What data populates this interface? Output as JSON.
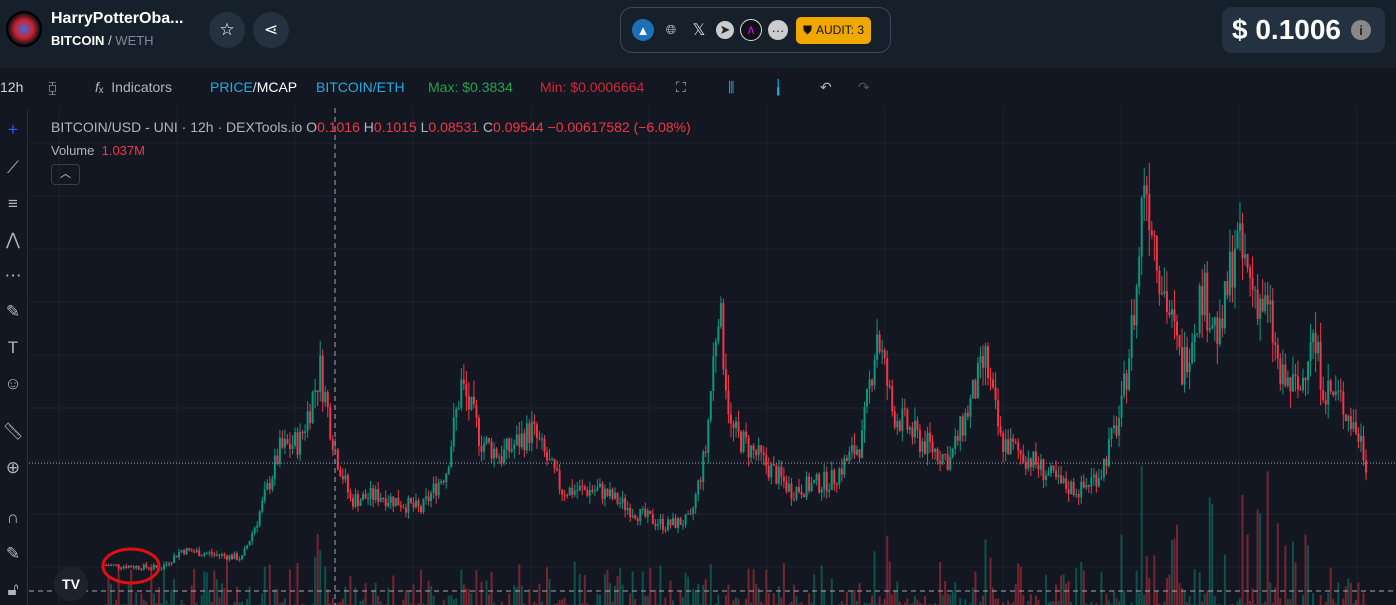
{
  "header": {
    "token_name": "HarryPotterOba...",
    "base": "BITCOIN",
    "quote": "WETH",
    "audit_label": "AUDIT: 3",
    "price": "$ 0.1006",
    "info": "i"
  },
  "toolbar": {
    "interval": "12h",
    "indicators": "Indicators",
    "price": "PRICE",
    "mcap": "MCAP",
    "pair_toggle": "BITCOIN/ETH",
    "max": "Max: $0.3834",
    "min": "Min: $0.0006664"
  },
  "legend": {
    "title": "BITCOIN/USD - UNI · 12h · DEXTools.io",
    "o_label": "O",
    "o": "0.1016",
    "h_label": "H",
    "h": "0.1015",
    "l_label": "L",
    "l": "0.08531",
    "c_label": "C",
    "c": "0.09544",
    "change": "−0.00617582 (−6.08%)",
    "volume_label": "Volume",
    "volume": "1.037M"
  },
  "colors": {
    "up": "#089981",
    "down": "#f23645",
    "accent": "#2962ff",
    "audit": "#f0a800"
  },
  "chart_data": {
    "type": "candlestick",
    "title": "BITCOIN/USD - UNI · 12h",
    "x_unit": "candle index (12h)",
    "ylim": [
      0,
      0.36
    ],
    "current_price": 0.1006,
    "path": [
      [
        0,
        0.0257
      ],
      [
        22,
        0.0235
      ],
      [
        30,
        0.0367
      ],
      [
        54,
        0.0308
      ],
      [
        60,
        0.0587
      ],
      [
        69,
        0.11
      ],
      [
        77,
        0.117
      ],
      [
        85,
        0.169
      ],
      [
        91,
        0.11
      ],
      [
        97,
        0.0734
      ],
      [
        109,
        0.0771
      ],
      [
        125,
        0.066
      ],
      [
        135,
        0.0954
      ],
      [
        141,
        0.158
      ],
      [
        149,
        0.117
      ],
      [
        157,
        0.106
      ],
      [
        169,
        0.125
      ],
      [
        181,
        0.0807
      ],
      [
        196,
        0.0807
      ],
      [
        212,
        0.0624
      ],
      [
        222,
        0.055
      ],
      [
        232,
        0.0587
      ],
      [
        238,
        0.11
      ],
      [
        243,
        0.22
      ],
      [
        248,
        0.125
      ],
      [
        260,
        0.103
      ],
      [
        272,
        0.0807
      ],
      [
        288,
        0.088
      ],
      [
        300,
        0.117
      ],
      [
        306,
        0.198
      ],
      [
        312,
        0.139
      ],
      [
        323,
        0.117
      ],
      [
        335,
        0.103
      ],
      [
        349,
        0.176
      ],
      [
        355,
        0.117
      ],
      [
        367,
        0.103
      ],
      [
        379,
        0.0844
      ],
      [
        387,
        0.0807
      ],
      [
        395,
        0.0954
      ],
      [
        403,
        0.139
      ],
      [
        409,
        0.228
      ],
      [
        412,
        0.316
      ],
      [
        419,
        0.235
      ],
      [
        427,
        0.169
      ],
      [
        435,
        0.228
      ],
      [
        442,
        0.191
      ],
      [
        448,
        0.264
      ],
      [
        454,
        0.235
      ],
      [
        462,
        0.206
      ],
      [
        466,
        0.161
      ],
      [
        474,
        0.154
      ],
      [
        478,
        0.198
      ],
      [
        484,
        0.154
      ],
      [
        490,
        0.147
      ],
      [
        498,
        0.117
      ],
      [
        500,
        0.1006
      ]
    ]
  }
}
